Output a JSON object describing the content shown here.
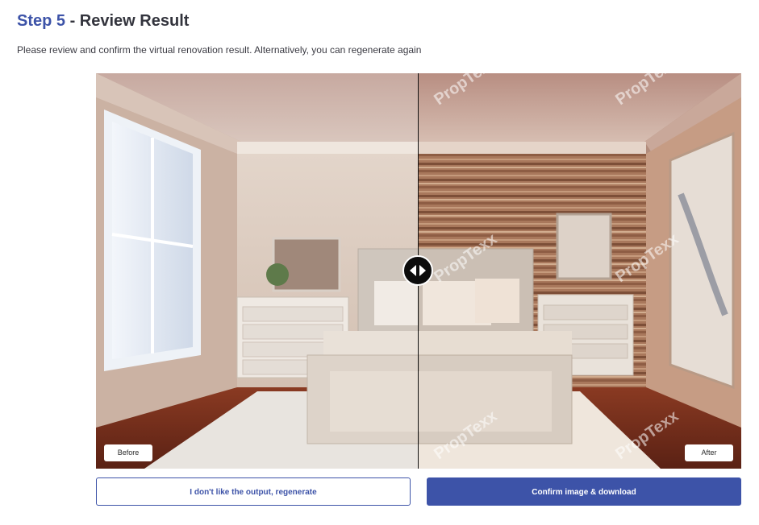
{
  "header": {
    "step_label": "Step 5",
    "title_rest": " - Review Result",
    "subtitle": "Please review and confirm the virtual renovation result. Alternatively, you can regenerate again"
  },
  "comparison": {
    "before_label": "Before",
    "after_label": "After",
    "watermark": "PropTexx",
    "slider_position": 0.5
  },
  "actions": {
    "regenerate_label": "I don't like the output, regenerate",
    "confirm_label": "Confirm image & download"
  },
  "colors": {
    "accent": "#3d53a8",
    "title_text": "#33343d"
  }
}
